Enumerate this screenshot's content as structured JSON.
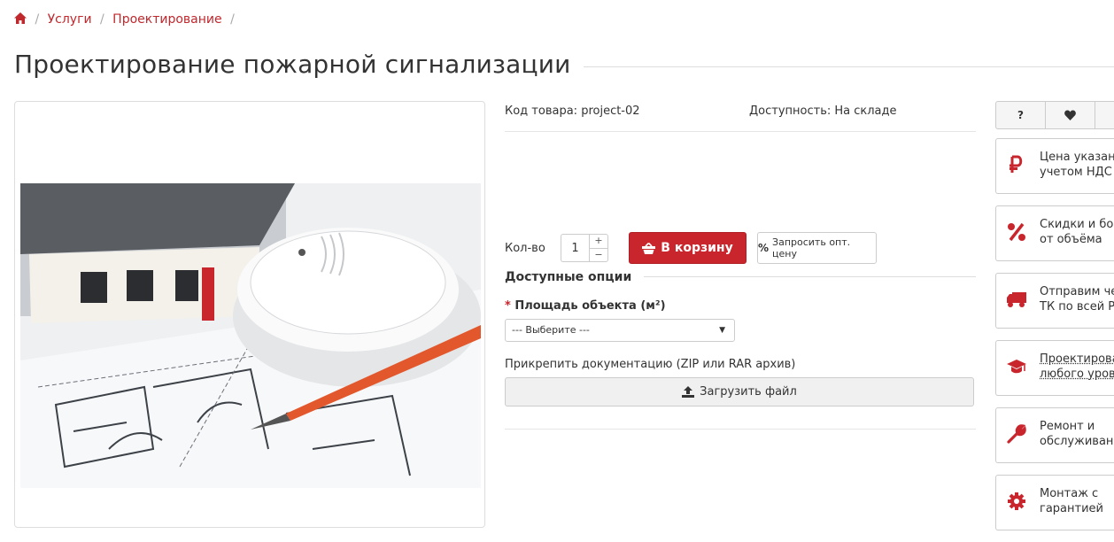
{
  "breadcrumb": {
    "home_icon": "home-icon",
    "items": [
      "Услуги",
      "Проектирование"
    ],
    "separator": "/"
  },
  "page": {
    "title": "Проектирование пожарной сигнализации"
  },
  "product": {
    "sku_label": "Код товара: project-02",
    "availability": "Доступность: На складе",
    "qty_label": "Кол-во",
    "qty_value": "1",
    "stepper_up": "+",
    "stepper_down": "−",
    "cart_button": "В корзину",
    "wholesale_button": "Запросить опт. цену",
    "image_alt": "Проектирование пожарной сигнализации"
  },
  "options": {
    "heading": "Доступные опции",
    "required_mark": "*",
    "area_label": "Площадь объекта (м²)",
    "area_select": "--- Выберите ---",
    "attach_label": "Прикрепить документацию (ZIP или RAR архив)",
    "upload_button": "Загрузить файл"
  },
  "sidebar": {
    "tabs": [
      {
        "label": "?",
        "icon": "question-icon"
      },
      {
        "label": "",
        "icon": "heart-icon"
      }
    ],
    "features": [
      {
        "icon": "ruble-icon",
        "line1": "Цена указана с",
        "line2": "учетом НДС"
      },
      {
        "icon": "percent-icon",
        "line1": "Скидки и бонусы",
        "line2": "от объёма"
      },
      {
        "icon": "truck-icon",
        "line1": "Отправим через",
        "line2": "ТК по всей РФ"
      },
      {
        "icon": "graduation-cap-icon",
        "line1": "Проектирование",
        "line2": "любого уровня"
      },
      {
        "icon": "wrench-icon",
        "line1": "Ремонт и",
        "line2": "обслуживание"
      },
      {
        "icon": "gear-icon",
        "line1": "Монтаж с",
        "line2": "гарантией"
      }
    ]
  },
  "colors": {
    "accent": "#c9252c",
    "link": "#c0282d",
    "border": "#dddddd"
  }
}
